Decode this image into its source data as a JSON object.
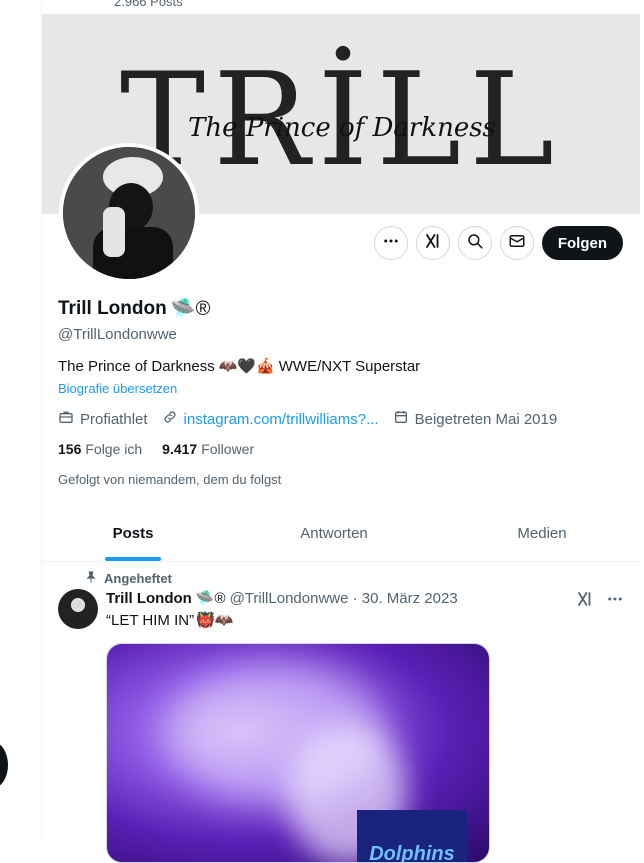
{
  "top": {
    "posts_count": "2.966 Posts"
  },
  "banner": {
    "title_text": "TRİLL",
    "script_text": "The Prince of Darkness"
  },
  "profile": {
    "display_name": "Trill London",
    "name_badges": "🛸®",
    "handle": "@TrillLondonwwe",
    "bio_text": "The Prince of Darkness",
    "bio_emojis": "🦇🖤🎪",
    "bio_suffix": "WWE/NXT Superstar",
    "translate_link": "Biografie übersetzen",
    "category": "Profiathlet",
    "website": "instagram.com/trillwilliams?...",
    "joined": "Beigetreten Mai 2019",
    "following_count": "156",
    "following_label": "Folge ich",
    "followers_count": "9.417",
    "followers_label": "Follower",
    "followed_by": "Gefolgt von niemandem, dem du folgst"
  },
  "actions": {
    "follow_label": "Folgen",
    "icons": [
      "more-icon",
      "grok-icon",
      "search-icon",
      "message-icon"
    ]
  },
  "tabs": [
    {
      "label": "Posts",
      "active": true
    },
    {
      "label": "Antworten",
      "active": false
    },
    {
      "label": "Medien",
      "active": false
    }
  ],
  "pinned_post": {
    "pinned_label": "Angeheftet",
    "author": "Trill London",
    "author_badges": "🛸®",
    "handle_date": "@TrillLondonwwe · 30. März 2023",
    "text": "“LET HIM IN”",
    "text_emojis": "👹🦇",
    "media_sign_text": "Dolphins"
  },
  "colors": {
    "accent": "#1d9bf0",
    "primary_text": "#0f1419",
    "secondary_text": "#536471"
  }
}
